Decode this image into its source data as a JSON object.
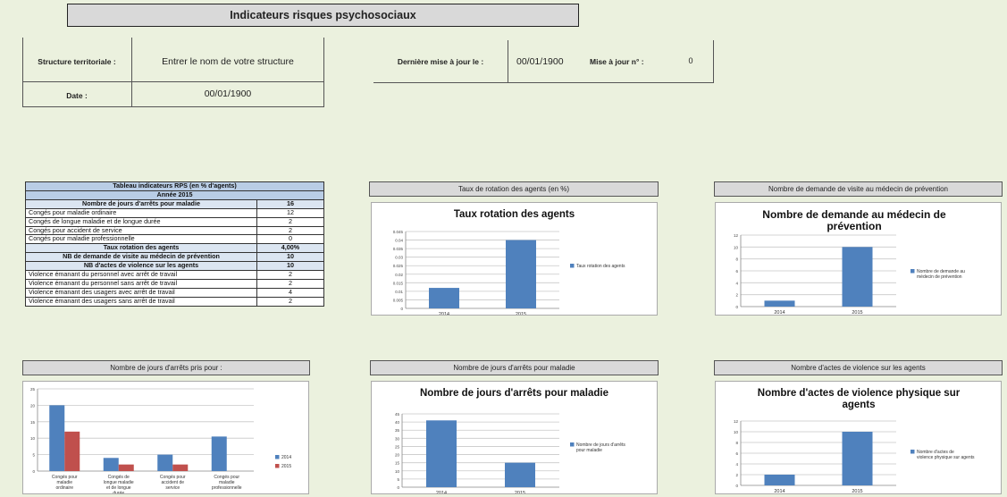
{
  "title": "Indicateurs risques psychosociaux",
  "info": {
    "structure_label": "Structure territoriale :",
    "structure_value": "Entrer le nom de votre structure",
    "date_label": "Date :",
    "date_value": "00/01/1900",
    "update_label": "Dernière mise à jour le :",
    "update_value": "00/01/1900",
    "update_no_label": "Mise à jour n° :",
    "update_no_value": "0"
  },
  "rps_table": {
    "title": "Tableau indicateurs RPS (en % d'agents)",
    "year": "Année 2015",
    "rows": [
      {
        "label": "Nombre de jours d'arrêts pour maladie",
        "value": "16",
        "kind": "c"
      },
      {
        "label": "Congés pour maladie ordinaire",
        "value": "12",
        "kind": "w"
      },
      {
        "label": "Congés de longue maladie et de longue durée",
        "value": "2",
        "kind": "w"
      },
      {
        "label": "Congés pour accident de service",
        "value": "2",
        "kind": "w"
      },
      {
        "label": "Congés pour maladie professionnelle",
        "value": "0",
        "kind": "w"
      },
      {
        "label": "Taux rotation des agents",
        "value": "4,00%",
        "kind": "c"
      },
      {
        "label": "NB de demande de visite au médecin de prévention",
        "value": "10",
        "kind": "c"
      },
      {
        "label": "NB d'actes de violence sur les agents",
        "value": "10",
        "kind": "c"
      },
      {
        "label": "Violence émanant du personnel avec arrêt de travail",
        "value": "2",
        "kind": "w"
      },
      {
        "label": "Violence émanant du personnel sans arrêt de travail",
        "value": "2",
        "kind": "w"
      },
      {
        "label": "Violence émanant des usagers avec arrêt de travail",
        "value": "4",
        "kind": "w"
      },
      {
        "label": "Violence émanant des usagers sans arrêt de travail",
        "value": "2",
        "kind": "w"
      }
    ]
  },
  "colors": {
    "blue": "#4f81bd",
    "red": "#c0504d",
    "background": "#ebf1de"
  },
  "panels": {
    "rotation_header": "Taux de rotation des agents (en %)",
    "visits_header": "Nombre de demande de visite au médecin de prévention",
    "jours_header": "Nombre de jours d'arrêts pris pour :",
    "maladie_header": "Nombre de jours d'arrêts pour maladie",
    "violence_header": "Nombre d'actes de violence sur les agents"
  },
  "chart_data": [
    {
      "id": "rotation",
      "type": "bar",
      "title": "Taux rotation des agents",
      "categories": [
        "2014",
        "2015"
      ],
      "series": [
        {
          "name": "Taux rotation des agents",
          "values": [
            0.012,
            0.04
          ]
        }
      ],
      "ylim": [
        0,
        0.045
      ],
      "yticks": [
        "0",
        "0.005",
        "0.01",
        "0.015",
        "0.02",
        "0.025",
        "0.03",
        "0.035",
        "0.04",
        "0.045"
      ],
      "legend": "right"
    },
    {
      "id": "visits",
      "type": "bar",
      "title": "Nombre de demande au médecin de prévention",
      "categories": [
        "2014",
        "2015"
      ],
      "series": [
        {
          "name": "Nombre de demande au médecin de prévention",
          "values": [
            1,
            10
          ]
        }
      ],
      "ylim": [
        0,
        12
      ],
      "yticks": [
        "0",
        "2",
        "4",
        "6",
        "8",
        "10",
        "12"
      ],
      "legend": "right"
    },
    {
      "id": "jours",
      "type": "bar",
      "title": "",
      "categories": [
        "Congés pour maladie ordinaire",
        "Congés de longue maladie et de longue durée",
        "Congés pour accident de service",
        "Congés pour maladie professionnelle"
      ],
      "series": [
        {
          "name": "2014",
          "values": [
            20,
            4,
            5,
            10.5
          ]
        },
        {
          "name": "2015",
          "values": [
            12,
            2,
            2,
            0
          ]
        }
      ],
      "ylim": [
        0,
        25
      ],
      "yticks": [
        "0",
        "5",
        "10",
        "15",
        "20",
        "25"
      ],
      "legend": "right"
    },
    {
      "id": "maladie",
      "type": "bar",
      "title": "Nombre de jours d'arrêts pour maladie",
      "categories": [
        "2014",
        "2015"
      ],
      "series": [
        {
          "name": "Nombre de jours d'arrêts pour maladie",
          "values": [
            41,
            15
          ]
        }
      ],
      "ylim": [
        0,
        45
      ],
      "yticks": [
        "0",
        "5",
        "10",
        "15",
        "20",
        "25",
        "30",
        "35",
        "40",
        "45"
      ],
      "legend": "right"
    },
    {
      "id": "violence",
      "type": "bar",
      "title": "Nombre d'actes de violence physique sur agents",
      "categories": [
        "2014",
        "2015"
      ],
      "series": [
        {
          "name": "Nombre d'actes de violence physique sur agents",
          "values": [
            2,
            10
          ]
        }
      ],
      "ylim": [
        0,
        12
      ],
      "yticks": [
        "0",
        "2",
        "4",
        "6",
        "8",
        "10",
        "12"
      ],
      "legend": "right"
    }
  ]
}
